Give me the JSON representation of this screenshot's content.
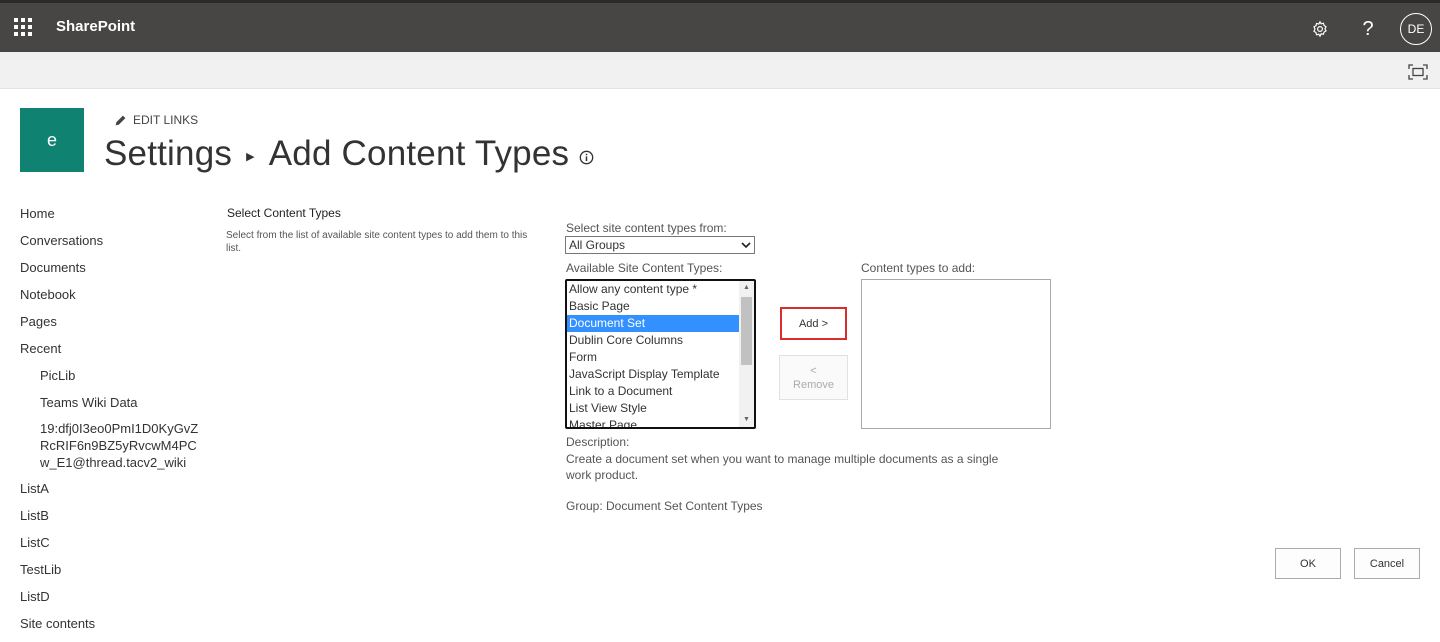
{
  "suitebar": {
    "brand": "SharePoint",
    "help_label": "?",
    "user_initials": "DE"
  },
  "site": {
    "logo_letter": "e",
    "edit_links": "EDIT LINKS",
    "breadcrumb_parent": "Settings",
    "breadcrumb_current": "Add Content Types"
  },
  "leftnav": {
    "items": [
      "Home",
      "Conversations",
      "Documents",
      "Notebook",
      "Pages",
      "Recent"
    ],
    "recent": [
      "PicLib",
      "Teams Wiki Data",
      "19:dfj0I3eo0PmI1D0KyGvZRcRIF6n9BZ5yRvcwM4PCw_E1@thread.tacv2_wiki"
    ],
    "bottom_items": [
      "ListA",
      "ListB",
      "ListC",
      "TestLib",
      "ListD",
      "Site contents"
    ]
  },
  "section": {
    "title": "Select Content Types",
    "description": "Select from the list of available site content types to add them to this list."
  },
  "form": {
    "select_from_label": "Select site content types from:",
    "select_from_value": "All Groups",
    "available_label": "Available Site Content Types:",
    "available_items": [
      "Allow any content type *",
      "Basic Page",
      "Document Set",
      "Dublin Core Columns",
      "Form",
      "JavaScript Display Template",
      "Link to a Document",
      "List View Style",
      "Master Page"
    ],
    "selected_item": "Document Set",
    "to_add_label": "Content types to add:",
    "add_button": "Add >",
    "remove_button_arrow": "<",
    "remove_button": "Remove",
    "description_label": "Description:",
    "description_text": "Create a document set when you want to manage multiple documents as a single work product.",
    "group_text": "Group: Document Set Content Types",
    "ok_button": "OK",
    "cancel_button": "Cancel"
  },
  "colors": {
    "suitebar": "#484644",
    "site_logo": "#108272",
    "selection": "#3390ff",
    "add_highlight": "#d92e2e"
  }
}
